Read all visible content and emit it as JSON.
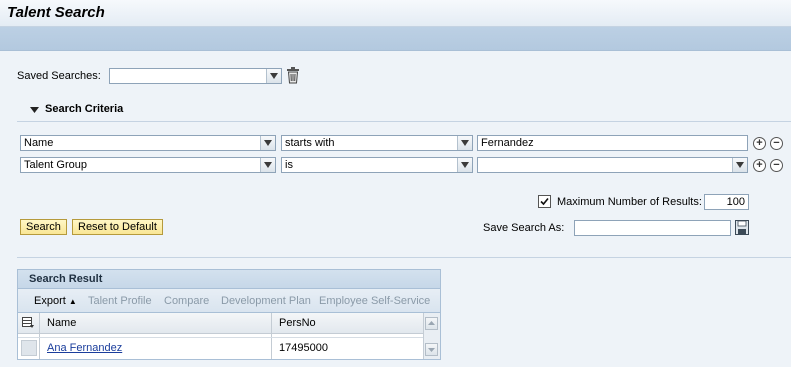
{
  "header": {
    "title": "Talent Search"
  },
  "saved_searches": {
    "label": "Saved Searches:",
    "value": ""
  },
  "criteria": {
    "section_label": "Search Criteria",
    "rows": [
      {
        "field": "Name",
        "operator": "starts with",
        "value": "Fernandez"
      },
      {
        "field": "Talent Group",
        "operator": "is",
        "value": ""
      }
    ]
  },
  "max_results": {
    "checked": true,
    "label": "Maximum Number of Results:",
    "value": "100"
  },
  "buttons": {
    "search": "Search",
    "reset": "Reset to Default"
  },
  "save_search": {
    "label": "Save Search As:",
    "value": ""
  },
  "result": {
    "title": "Search Result",
    "toolbar": [
      "Export",
      "Talent Profile",
      "Compare",
      "Development Plan",
      "Employee Self-Service"
    ],
    "columns": [
      "Name",
      "PersNo"
    ],
    "rows": [
      {
        "name": "Ana Fernandez",
        "persno": "17495000"
      }
    ]
  }
}
